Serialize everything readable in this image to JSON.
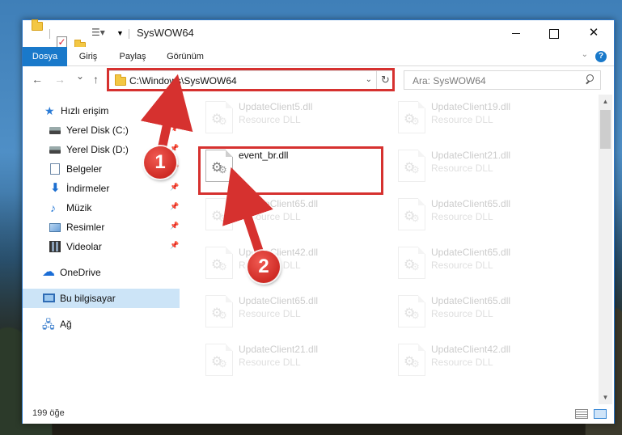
{
  "window": {
    "title": "SysWOW64",
    "minimize_icon": "minimize-icon",
    "maximize_icon": "maximize-icon",
    "close_label": "✕"
  },
  "ribbon": {
    "tabs": [
      {
        "label": "Dosya",
        "active": true
      },
      {
        "label": "Giriş",
        "active": false
      },
      {
        "label": "Paylaş",
        "active": false
      },
      {
        "label": "Görünüm",
        "active": false
      }
    ],
    "help_label": "?"
  },
  "nav": {
    "back": "←",
    "forward": "→",
    "recent": "⌄",
    "up": "↑",
    "address": "C:\\Windows\\SysWOW64",
    "search_placeholder": "Ara: SysWOW64"
  },
  "sidebar": {
    "items": [
      {
        "label": "Hızlı erişim",
        "icon": "star-icon"
      },
      {
        "label": "Yerel Disk (C:)",
        "icon": "disk-icon",
        "pinned": true
      },
      {
        "label": "Yerel Disk (D:)",
        "icon": "disk-icon",
        "pinned": true
      },
      {
        "label": "Belgeler",
        "icon": "documents-icon",
        "pinned": true
      },
      {
        "label": "İndirmeler",
        "icon": "downloads-icon",
        "pinned": true
      },
      {
        "label": "Müzik",
        "icon": "music-icon",
        "pinned": true
      },
      {
        "label": "Resimler",
        "icon": "pictures-icon",
        "pinned": true
      },
      {
        "label": "Videolar",
        "icon": "videos-icon",
        "pinned": true
      },
      {
        "label": "OneDrive",
        "icon": "onedrive-icon"
      },
      {
        "label": "Bu bilgisayar",
        "icon": "this-pc-icon",
        "selected": true
      },
      {
        "label": "Ağ",
        "icon": "network-icon"
      }
    ]
  },
  "files": {
    "left": [
      {
        "name": "UpdateClient5.dll",
        "type": "Resource DLL",
        "faded": true
      },
      {
        "name": "event_br.dll",
        "type": "",
        "faded": false
      },
      {
        "name": "UpdateClient65.dll",
        "type": "Resource DLL",
        "faded": true
      },
      {
        "name": "UpdateClient42.dll",
        "type": "Resource DLL",
        "faded": true
      },
      {
        "name": "UpdateClient65.dll",
        "type": "Resource DLL",
        "faded": true
      },
      {
        "name": "UpdateClient21.dll",
        "type": "Resource DLL",
        "faded": true
      }
    ],
    "right": [
      {
        "name": "UpdateClient19.dll",
        "type": "Resource DLL",
        "faded": true
      },
      {
        "name": "UpdateClient21.dll",
        "type": "Resource DLL",
        "faded": true
      },
      {
        "name": "UpdateClient65.dll",
        "type": "Resource DLL",
        "faded": true
      },
      {
        "name": "UpdateClient65.dll",
        "type": "Resource DLL",
        "faded": true
      },
      {
        "name": "UpdateClient65.dll",
        "type": "Resource DLL",
        "faded": true
      },
      {
        "name": "UpdateClient42.dll",
        "type": "Resource DLL",
        "faded": true
      }
    ]
  },
  "status": {
    "item_count": "199 öğe"
  },
  "annotations": {
    "callout_1": "1",
    "callout_2": "2",
    "color": "#d6312f"
  },
  "colors": {
    "accent": "#1979ca",
    "selection": "#cce4f7",
    "highlight": "#d6312f"
  }
}
